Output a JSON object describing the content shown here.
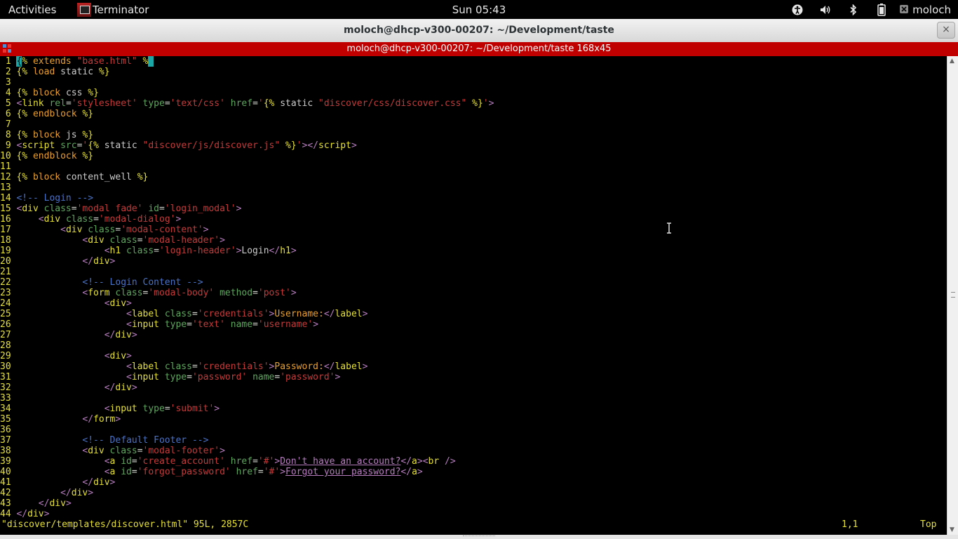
{
  "topbar": {
    "activities": "Activities",
    "app_name": "Terminator",
    "clock": "Sun 05:43",
    "user": "moloch"
  },
  "window": {
    "title": "moloch@dhcp-v300-00207: ~/Development/taste",
    "close_glyph": "×"
  },
  "terminal": {
    "title": "moloch@dhcp-v300-00207: ~/Development/taste 168x45"
  },
  "editor": {
    "status_file": "\"discover/templates/discover.html\" 95L, 2857C",
    "status_pos": "1,1",
    "status_scroll": "Top"
  },
  "icons": [
    "accessibility-icon",
    "volume-icon",
    "bluetooth-icon",
    "battery-icon",
    "user-icon",
    "terminator-icon",
    "close-icon"
  ],
  "colors": {
    "terminator_bar": "#c00000",
    "line_number": "#e5e035",
    "string": "#c43a3a",
    "tag": "#b77dbf",
    "attribute": "#5fa55f",
    "comment": "#4a72c4",
    "cursor": "#1ca7a7"
  }
}
